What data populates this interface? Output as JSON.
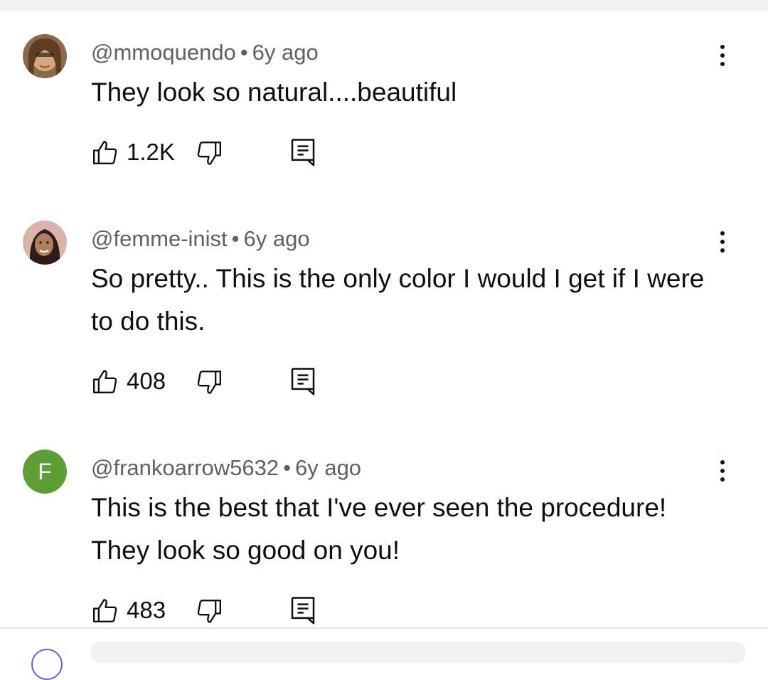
{
  "comments": [
    {
      "handle": "@mmoquendo",
      "time": "6y ago",
      "text": "They look so natural....beautiful",
      "likes": "1.2K",
      "avatar": {
        "type": "photo",
        "colors": [
          "#b88a5e",
          "#7a5234"
        ]
      }
    },
    {
      "handle": "@femme-inist",
      "time": "6y ago",
      "text": "So pretty.. This is the only color I would I get if I were to do this.",
      "likes": "408",
      "avatar": {
        "type": "photo",
        "colors": [
          "#caa39a",
          "#3a2520"
        ]
      }
    },
    {
      "handle": "@frankoarrow5632",
      "time": "6y ago",
      "text": "This is the best that I've ever seen the procedure! They look so good on you!",
      "likes": "483",
      "avatar": {
        "type": "letter",
        "letter": "F",
        "color": "#5e9e37"
      }
    }
  ],
  "separator": "•",
  "icons": {
    "like": "thumb-up-icon",
    "dislike": "thumb-down-icon",
    "reply": "reply-icon",
    "more": "more-vert-icon"
  }
}
